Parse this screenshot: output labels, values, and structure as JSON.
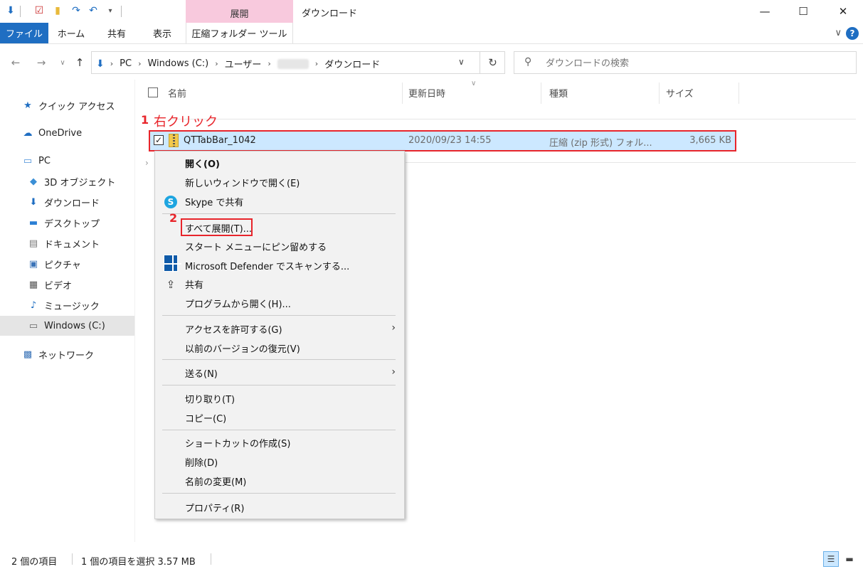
{
  "titlebar": {
    "contextual_tab": "展開",
    "window_title": "ダウンロード",
    "minimize_glyph": "—",
    "maximize_glyph": "☐",
    "close_glyph": "✕"
  },
  "ribbon": {
    "tabs": [
      "ファイル",
      "ホーム",
      "共有",
      "表示",
      "圧縮フォルダー ツール"
    ],
    "expand_glyph": "∨",
    "help_glyph": "?"
  },
  "address": {
    "crumbs": [
      "PC",
      "Windows (C:)",
      "ユーザー",
      "ダウンロード"
    ],
    "search_placeholder": "ダウンロードの検索"
  },
  "sidebar": {
    "items": [
      {
        "label": "クイック アクセス",
        "icon": "star-icon"
      },
      {
        "label": "OneDrive",
        "icon": "cloud-icon"
      },
      {
        "label": "PC",
        "icon": "computer-icon"
      },
      {
        "label": "3D オブジェクト",
        "icon": "cube-icon"
      },
      {
        "label": "ダウンロード",
        "icon": "download-arrow-icon"
      },
      {
        "label": "デスクトップ",
        "icon": "desktop-icon"
      },
      {
        "label": "ドキュメント",
        "icon": "document-icon"
      },
      {
        "label": "ピクチャ",
        "icon": "picture-icon"
      },
      {
        "label": "ビデオ",
        "icon": "video-icon"
      },
      {
        "label": "ミュージック",
        "icon": "music-icon"
      },
      {
        "label": "Windows (C:)",
        "icon": "drive-icon",
        "selected": true
      },
      {
        "label": "ネットワーク",
        "icon": "network-icon"
      }
    ]
  },
  "columns": {
    "name": "名前",
    "modified": "更新日時",
    "type": "種類",
    "size": "サイズ"
  },
  "file": {
    "name": "QTTabBar_1042",
    "modified": "2020/09/23 14:55",
    "type": "圧縮 (zip 形式) フォル...",
    "size": "3,665 KB",
    "checked": "✓"
  },
  "annotations": {
    "step1_number": "1",
    "step1_text": "右クリック",
    "step2_number": "2"
  },
  "context_menu": {
    "items": {
      "open": "開く(O)",
      "open_new_window": "新しいウィンドウで開く(E)",
      "skype_share": "Skype で共有",
      "extract_all": "すべて展開(T)...",
      "pin_start": "スタート メニューにピン留めする",
      "defender_scan": "Microsoft Defender でスキャンする...",
      "share": "共有",
      "open_with": "プログラムから開く(H)...",
      "give_access": "アクセスを許可する(G)",
      "restore_versions": "以前のバージョンの復元(V)",
      "send_to": "送る(N)",
      "cut": "切り取り(T)",
      "copy": "コピー(C)",
      "create_shortcut": "ショートカットの作成(S)",
      "delete": "削除(D)",
      "rename": "名前の変更(M)",
      "properties": "プロパティ(R)"
    }
  },
  "statusbar": {
    "item_count": "2 個の項目",
    "selection": "1 個の項目を選択  3.57 MB"
  },
  "colors": {
    "accent": "#1f6ec2",
    "contextual_tab_bg": "#f8c9dd",
    "selection_bg": "#cce8ff",
    "annotation_red": "#e8252b"
  }
}
